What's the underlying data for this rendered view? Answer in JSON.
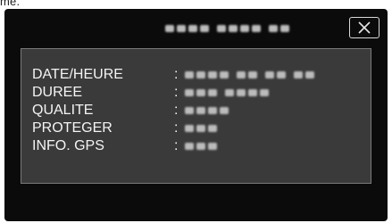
{
  "top_fragment": "me.",
  "header": {
    "title": "",
    "close_icon": "close-x-icon"
  },
  "info_panel": {
    "separator": ":",
    "rows": [
      {
        "label": "DATE/HEURE",
        "value": ""
      },
      {
        "label": "DUREE",
        "value": ""
      },
      {
        "label": "QUALITE",
        "value": ""
      },
      {
        "label": "PROTEGER",
        "value": ""
      },
      {
        "label": "INFO. GPS",
        "value": ""
      }
    ]
  },
  "colors": {
    "screen_background": "#0b0b0b",
    "panel_background": "#3a3a3a",
    "panel_border": "#7a7a7a",
    "text": "#f4f4f4"
  }
}
